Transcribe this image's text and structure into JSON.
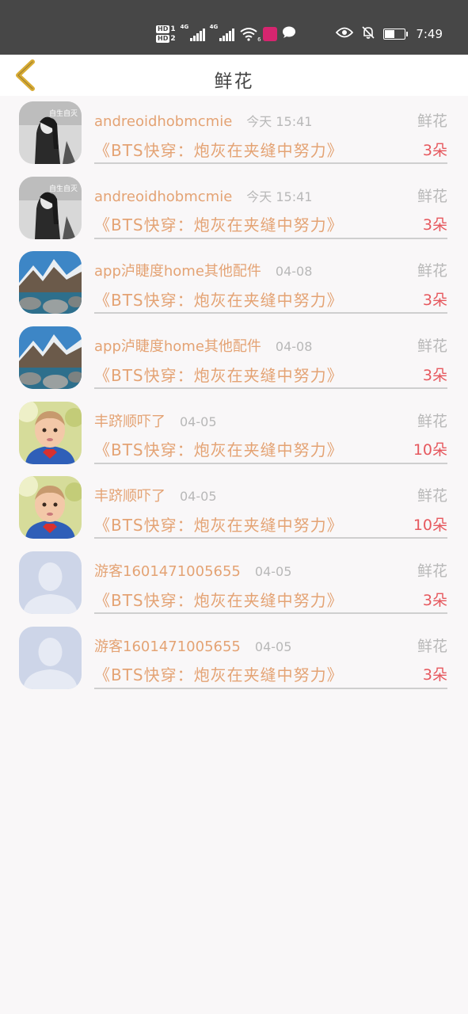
{
  "status_bar": {
    "hd1": "HD",
    "hd1_num": "1",
    "hd2": "HD",
    "hd2_num": "2",
    "net1": "4G",
    "net2": "4G",
    "wifi_tag": "6",
    "time": "7:49",
    "battery_level": 0.45
  },
  "nav": {
    "title": "鲜花"
  },
  "rows": [
    {
      "name": "andreoidhobmcmie",
      "time": "今天  15:41",
      "gift": "鲜花",
      "book": "《BTS快穿：炮灰在夹缝中努力》",
      "count": "3朵",
      "avatar": "woman-photo",
      "avatar_text": "自生自灭"
    },
    {
      "name": "andreoidhobmcmie",
      "time": "今天  15:41",
      "gift": "鲜花",
      "book": "《BTS快穿：炮灰在夹缝中努力》",
      "count": "3朵",
      "avatar": "woman-photo",
      "avatar_text": "自生自灭"
    },
    {
      "name": "app泸睫度home其他配件",
      "time": "04-08",
      "gift": "鲜花",
      "book": "《BTS快穿：炮灰在夹缝中努力》",
      "count": "3朵",
      "avatar": "mountain-photo"
    },
    {
      "name": "app泸睫度home其他配件",
      "time": "04-08",
      "gift": "鲜花",
      "book": "《BTS快穿：炮灰在夹缝中努力》",
      "count": "3朵",
      "avatar": "mountain-photo"
    },
    {
      "name": "丰跻顺吓了",
      "time": "04-05",
      "gift": "鲜花",
      "book": "《BTS快穿：炮灰在夹缝中努力》",
      "count": "10朵",
      "avatar": "child-photo"
    },
    {
      "name": "丰跻顺吓了",
      "time": "04-05",
      "gift": "鲜花",
      "book": "《BTS快穿：炮灰在夹缝中努力》",
      "count": "10朵",
      "avatar": "child-photo"
    },
    {
      "name": "游客1601471005655",
      "time": "04-05",
      "gift": "鲜花",
      "book": "《BTS快穿：炮灰在夹缝中努力》",
      "count": "3朵",
      "avatar": "default-user"
    },
    {
      "name": "游客1601471005655",
      "time": "04-05",
      "gift": "鲜花",
      "book": "《BTS快穿：炮灰在夹缝中努力》",
      "count": "3朵",
      "avatar": "default-user"
    }
  ],
  "colors": {
    "status_bg": "#474747",
    "name": "#e4a374",
    "muted": "#b8b8b8",
    "count": "#e6585e",
    "back_arrow": "#d8ab33",
    "page_bg": "#f9f7f8"
  }
}
